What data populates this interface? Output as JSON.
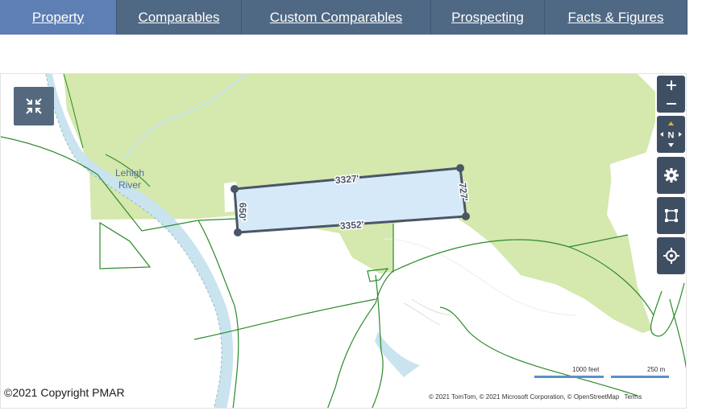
{
  "tabs": [
    {
      "label": "Property",
      "active": true
    },
    {
      "label": "Comparables",
      "active": false
    },
    {
      "label": "Custom Comparables",
      "active": false
    },
    {
      "label": "Prospecting",
      "active": false
    },
    {
      "label": "Facts & Figures",
      "active": false
    }
  ],
  "map": {
    "river_label_line1": "Lehigh",
    "river_label_line2": "River",
    "parcel_dimensions": {
      "top": "3327'",
      "bottom": "3352'",
      "left": "650'",
      "right": "727'"
    },
    "scale": {
      "imperial": "1000 feet",
      "metric": "250 m"
    },
    "attribution": "© 2021 TomTom, © 2021 Microsoft Corporation, © OpenStreetMap",
    "terms_label": "Terms",
    "copyright": "©2021 Copyright PMAR",
    "compass_label": "N",
    "controls": [
      "zoom-in",
      "zoom-out",
      "compass",
      "settings",
      "draw-rectangle",
      "locate"
    ]
  },
  "colors": {
    "tab_bg": "#4f6884",
    "tab_active_bg": "#5d7fb3",
    "forest": "#d5e8ad",
    "water": "#c9e3ef",
    "parcel_fill": "#d6e9f8",
    "parcel_stroke": "#4a5666",
    "boundary": "#2a8a2a",
    "control_bg": "#3f4f63"
  }
}
